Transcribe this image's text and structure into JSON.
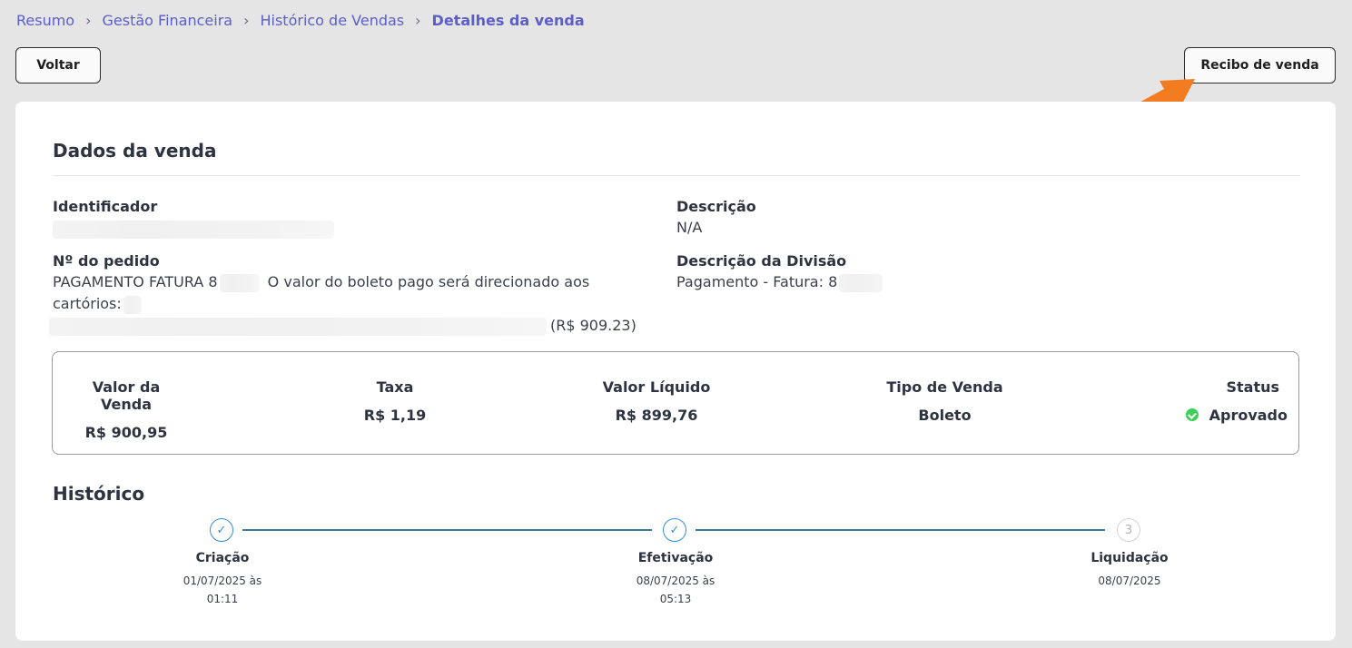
{
  "breadcrumb": {
    "items": [
      "Resumo",
      "Gestão Financeira",
      "Histórico de Vendas"
    ],
    "current": "Detalhes da venda",
    "separator": "›"
  },
  "actions": {
    "back_label": "Voltar",
    "receipt_label": "Recibo de venda"
  },
  "sale": {
    "section_title": "Dados da venda",
    "identifier_label": "Identificador",
    "order_label": "Nº do pedido",
    "order_value_start": "PAGAMENTO FATURA 8",
    "order_value_mid": "O valor do boleto pago será direcionado aos cartórios:",
    "order_value_end": "(R$ 909.23)",
    "description_label": "Descrição",
    "description_value": "N/A",
    "division_label": "Descrição da Divisão",
    "division_value": "Pagamento - Fatura: 8"
  },
  "summary": {
    "sale_value_label": "Valor da Venda",
    "sale_value": "R$ 900,95",
    "fee_label": "Taxa",
    "fee_value": "R$ 1,19",
    "net_label": "Valor Líquido",
    "net_value": "R$ 899,76",
    "type_label": "Tipo de Venda",
    "type_value": "Boleto",
    "status_label": "Status",
    "status_value": "Aprovado",
    "status_color": "#3ecf58"
  },
  "history": {
    "title": "Histórico",
    "steps": [
      {
        "label": "Criação",
        "date": "01/07/2025 às",
        "time": "01:11",
        "state": "done",
        "icon": "check-icon"
      },
      {
        "label": "Efetivação",
        "date": "08/07/2025 às",
        "time": "05:13",
        "state": "done",
        "icon": "check-icon"
      },
      {
        "label": "Liquidação",
        "date": "08/07/2025",
        "time": "",
        "number": "3",
        "state": "pending"
      }
    ]
  },
  "colors": {
    "accent": "#5b5fc7",
    "arrow": "#f47c20",
    "step_done": "#3a8ed8"
  }
}
